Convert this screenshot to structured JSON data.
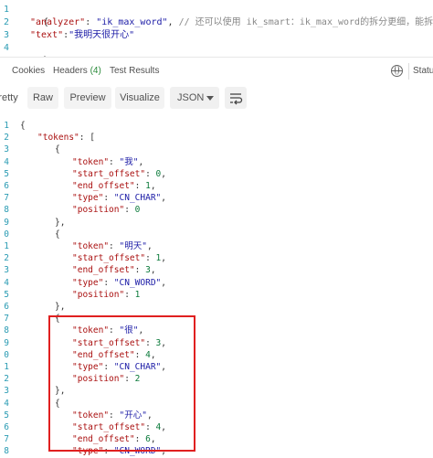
{
  "request": {
    "line_numbers": [
      "1",
      "2",
      "3",
      "4"
    ],
    "open_brace": "{",
    "close_brace": "}",
    "analyzer_key": "\"analyzer\"",
    "analyzer_value": "\"ik_max_word\"",
    "comment": "// 还可以使用 ik_smart：ik_max_word的拆分更细，能拆除更多单词",
    "text_key": "\"text\"",
    "text_value": "\"我明天很开心\""
  },
  "tabs": {
    "cookies": "Cookies",
    "headers": "Headers",
    "headers_count": "(4)",
    "test_results": "Test Results",
    "status": "Status"
  },
  "toolbar": {
    "pretty": "retty",
    "raw": "Raw",
    "preview": "Preview",
    "visualize": "Visualize",
    "format": "JSON"
  },
  "response": {
    "line_numbers": [
      "1",
      "2",
      "3",
      "4",
      "5",
      "6",
      "7",
      "8",
      "9",
      "0",
      "1",
      "2",
      "3",
      "4",
      "5",
      "6",
      "7",
      "8",
      "9",
      "0",
      "1",
      "2",
      "3",
      "4",
      "5",
      "6",
      "7",
      "8"
    ],
    "lines": [
      {
        "indent": 0,
        "parts": [
          [
            "p",
            "{"
          ]
        ]
      },
      {
        "indent": 1,
        "parts": [
          [
            "k",
            "\"tokens\""
          ],
          [
            "p",
            ": ["
          ]
        ]
      },
      {
        "indent": 2,
        "parts": [
          [
            "p",
            "{"
          ]
        ]
      },
      {
        "indent": 3,
        "parts": [
          [
            "k",
            "\"token\""
          ],
          [
            "p",
            ": "
          ],
          [
            "s",
            "\"我\""
          ],
          [
            "p",
            ","
          ]
        ]
      },
      {
        "indent": 3,
        "parts": [
          [
            "k",
            "\"start_offset\""
          ],
          [
            "p",
            ": "
          ],
          [
            "n",
            "0"
          ],
          [
            "p",
            ","
          ]
        ]
      },
      {
        "indent": 3,
        "parts": [
          [
            "k",
            "\"end_offset\""
          ],
          [
            "p",
            ": "
          ],
          [
            "n",
            "1"
          ],
          [
            "p",
            ","
          ]
        ]
      },
      {
        "indent": 3,
        "parts": [
          [
            "k",
            "\"type\""
          ],
          [
            "p",
            ": "
          ],
          [
            "s",
            "\"CN_CHAR\""
          ],
          [
            "p",
            ","
          ]
        ]
      },
      {
        "indent": 3,
        "parts": [
          [
            "k",
            "\"position\""
          ],
          [
            "p",
            ": "
          ],
          [
            "n",
            "0"
          ]
        ]
      },
      {
        "indent": 2,
        "parts": [
          [
            "p",
            "},"
          ]
        ]
      },
      {
        "indent": 2,
        "parts": [
          [
            "p",
            "{"
          ]
        ]
      },
      {
        "indent": 3,
        "parts": [
          [
            "k",
            "\"token\""
          ],
          [
            "p",
            ": "
          ],
          [
            "s",
            "\"明天\""
          ],
          [
            "p",
            ","
          ]
        ]
      },
      {
        "indent": 3,
        "parts": [
          [
            "k",
            "\"start_offset\""
          ],
          [
            "p",
            ": "
          ],
          [
            "n",
            "1"
          ],
          [
            "p",
            ","
          ]
        ]
      },
      {
        "indent": 3,
        "parts": [
          [
            "k",
            "\"end_offset\""
          ],
          [
            "p",
            ": "
          ],
          [
            "n",
            "3"
          ],
          [
            "p",
            ","
          ]
        ]
      },
      {
        "indent": 3,
        "parts": [
          [
            "k",
            "\"type\""
          ],
          [
            "p",
            ": "
          ],
          [
            "s",
            "\"CN_WORD\""
          ],
          [
            "p",
            ","
          ]
        ]
      },
      {
        "indent": 3,
        "parts": [
          [
            "k",
            "\"position\""
          ],
          [
            "p",
            ": "
          ],
          [
            "n",
            "1"
          ]
        ]
      },
      {
        "indent": 2,
        "parts": [
          [
            "p",
            "},"
          ]
        ]
      },
      {
        "indent": 2,
        "parts": [
          [
            "p",
            "{"
          ]
        ]
      },
      {
        "indent": 3,
        "parts": [
          [
            "k",
            "\"token\""
          ],
          [
            "p",
            ": "
          ],
          [
            "s",
            "\"很\""
          ],
          [
            "p",
            ","
          ]
        ]
      },
      {
        "indent": 3,
        "parts": [
          [
            "k",
            "\"start_offset\""
          ],
          [
            "p",
            ": "
          ],
          [
            "n",
            "3"
          ],
          [
            "p",
            ","
          ]
        ]
      },
      {
        "indent": 3,
        "parts": [
          [
            "k",
            "\"end_offset\""
          ],
          [
            "p",
            ": "
          ],
          [
            "n",
            "4"
          ],
          [
            "p",
            ","
          ]
        ]
      },
      {
        "indent": 3,
        "parts": [
          [
            "k",
            "\"type\""
          ],
          [
            "p",
            ": "
          ],
          [
            "s",
            "\"CN_CHAR\""
          ],
          [
            "p",
            ","
          ]
        ]
      },
      {
        "indent": 3,
        "parts": [
          [
            "k",
            "\"position\""
          ],
          [
            "p",
            ": "
          ],
          [
            "n",
            "2"
          ]
        ]
      },
      {
        "indent": 2,
        "parts": [
          [
            "p",
            "},"
          ]
        ]
      },
      {
        "indent": 2,
        "parts": [
          [
            "p",
            "{"
          ]
        ]
      },
      {
        "indent": 3,
        "parts": [
          [
            "k",
            "\"token\""
          ],
          [
            "p",
            ": "
          ],
          [
            "s",
            "\"开心\""
          ],
          [
            "p",
            ","
          ]
        ]
      },
      {
        "indent": 3,
        "parts": [
          [
            "k",
            "\"start_offset\""
          ],
          [
            "p",
            ": "
          ],
          [
            "n",
            "4"
          ],
          [
            "p",
            ","
          ]
        ]
      },
      {
        "indent": 3,
        "parts": [
          [
            "k",
            "\"end_offset\""
          ],
          [
            "p",
            ": "
          ],
          [
            "n",
            "6"
          ],
          [
            "p",
            ","
          ]
        ]
      },
      {
        "indent": 3,
        "parts": [
          [
            "k",
            "\"type\""
          ],
          [
            "p",
            ": "
          ],
          [
            "s",
            "\"CN_WORD\""
          ],
          [
            "p",
            ","
          ]
        ]
      }
    ]
  },
  "colors": {
    "highlight_border": "#e02020",
    "line_number": "#2a9bb3",
    "json_key": "#aa1111",
    "json_string": "#1a1aa6"
  }
}
